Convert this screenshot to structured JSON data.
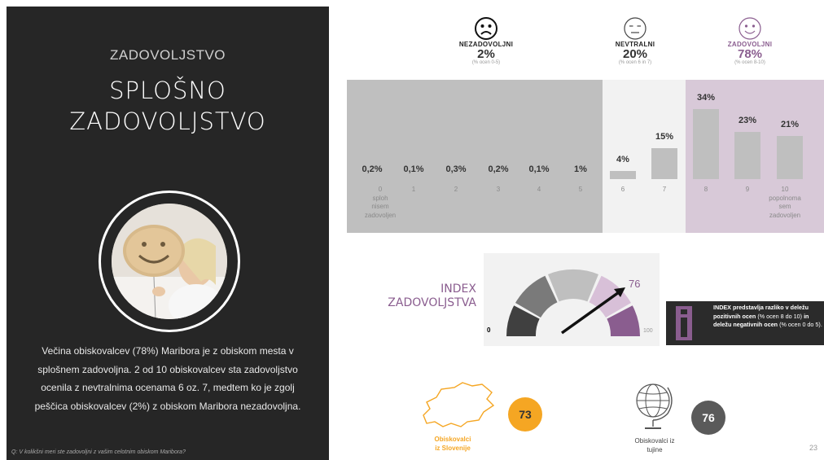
{
  "left_panel": {
    "kicker": "ZADOVOLJSTVO",
    "title_line1": "SPLOŠNO",
    "title_line2": "ZADOVOLJSTVO",
    "body_text": "Večina obiskovalcev (78%) Maribora je z obiskom mesta v splošnem zadovoljna. 2 od 10 obiskovalcev sta zadovoljstvo ocenila z nevtralnima ocenama 6 oz. 7, medtem ko je zgolj peščica obiskovalcev (2%) z obiskom Maribora nezadovoljna.",
    "question": "Q: V kolikšni meri ste zadovoljni z vašim celotnim obiskom Maribora?"
  },
  "categories": [
    {
      "name": "NEZADOVOLJNI",
      "pct": "2%",
      "sub": "(% ocen 0-5)",
      "face_icon": "sad-face-icon"
    },
    {
      "name": "NEVTRALNI",
      "pct": "20%",
      "sub": "(% ocen 6 in 7)",
      "face_icon": "neutral-face-icon"
    },
    {
      "name": "ZADOVOLJNI",
      "pct": "78%",
      "sub": "(% ocen 8-10)",
      "face_icon": "happy-face-icon"
    }
  ],
  "chart_data": {
    "type": "bar",
    "categories": [
      "0",
      "1",
      "2",
      "3",
      "4",
      "5",
      "6",
      "7",
      "8",
      "9",
      "10"
    ],
    "values": [
      0.2,
      0.1,
      0.3,
      0.2,
      0.1,
      1,
      4,
      15,
      34,
      23,
      21
    ],
    "value_labels": [
      "0,2%",
      "0,1%",
      "0,3%",
      "0,2%",
      "0,1%",
      "1%",
      "4%",
      "15%",
      "34%",
      "23%",
      "21%"
    ],
    "tick_sublabels": {
      "0": "splоh nisem zadovoljen",
      "10": "popolnoma sem zadovoljen"
    },
    "zone_colors": {
      "negative": "#bfbfbf",
      "neutral": "#f2f2f2",
      "positive": "#d8c9d8"
    },
    "bar_color": "#bfbfbf"
  },
  "tick_0_lines": [
    "0",
    "sploh",
    "nisem",
    "zadovoljen"
  ],
  "tick_10_lines": [
    "10",
    "popolnoma",
    "sem",
    "zadovoljen"
  ],
  "index": {
    "label_line1": "INDEX",
    "label_line2": "ZADOVOLJSTVA",
    "value": "76",
    "min": "0",
    "max": "100",
    "info_bold1": "INDEX predstavlja razliko v deležu",
    "info_bold2": "pozitivnih ocen",
    "info_normal1": "(% ocen 8 do 10)",
    "info_bold3": "in",
    "info_bold4": "deležu negativnih ocen",
    "info_normal2": "(% ocen 0 do 5).",
    "accent": "#8a5d8f"
  },
  "groups": [
    {
      "label_line1": "Obiskovalci",
      "label_line2": "iz Slovenije",
      "value": "73",
      "color": "#f5a623",
      "icon": "slovenia-map-icon"
    },
    {
      "label_line1": "Obiskovalci iz",
      "label_line2": "tujine",
      "value": "76",
      "color": "#5a5a5a",
      "icon": "globe-icon"
    }
  ],
  "page_number": "23"
}
